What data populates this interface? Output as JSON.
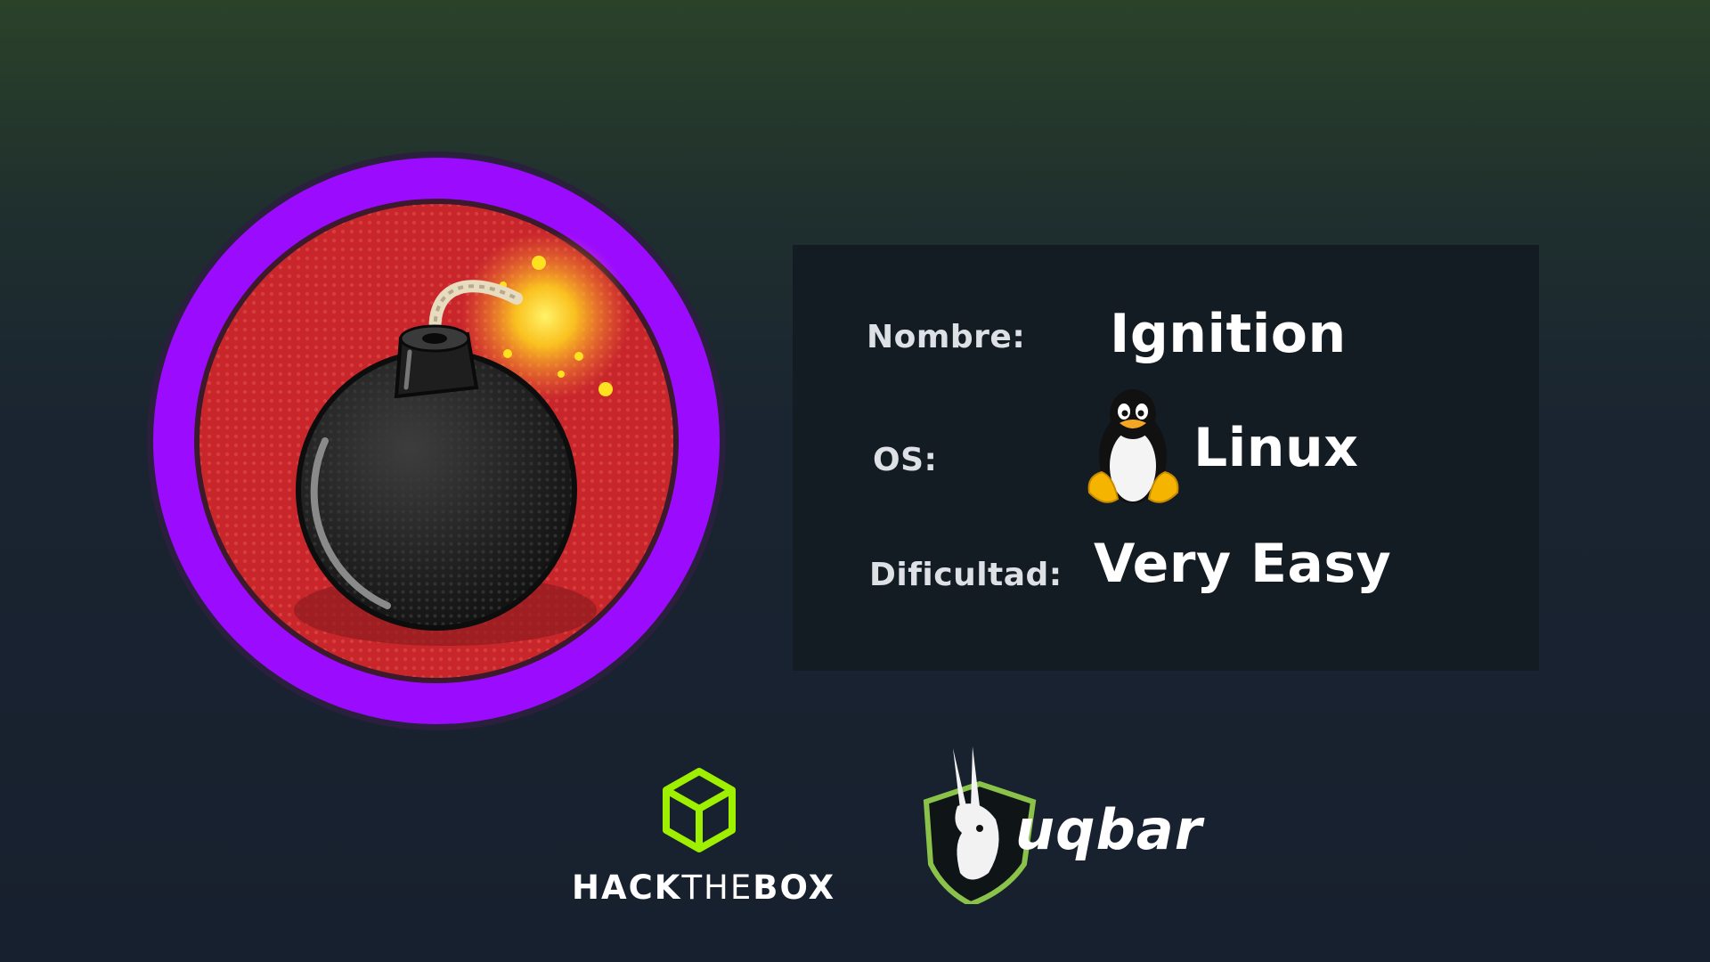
{
  "machine": {
    "name_label": "Nombre:",
    "name_value": "Ignition",
    "os_label": "OS:",
    "os_value": "Linux",
    "difficulty_label": "Dificultad:",
    "difficulty_value": "Very Easy"
  },
  "logos": {
    "htb_text_bold1": "HACK",
    "htb_text_thin": "THE",
    "htb_text_bold2": "BOX",
    "uqbar_text": "uqbar"
  },
  "colors": {
    "badge_ring": "#9b0cff",
    "badge_inner": "#c8262b",
    "htb_green": "#9fef00",
    "uqbar_green": "#8bc34a"
  },
  "icons": {
    "badge": "bomb-icon",
    "os": "tux-penguin-icon",
    "htb": "hackthebox-cube-icon",
    "uqbar": "rabbit-shield-icon"
  }
}
